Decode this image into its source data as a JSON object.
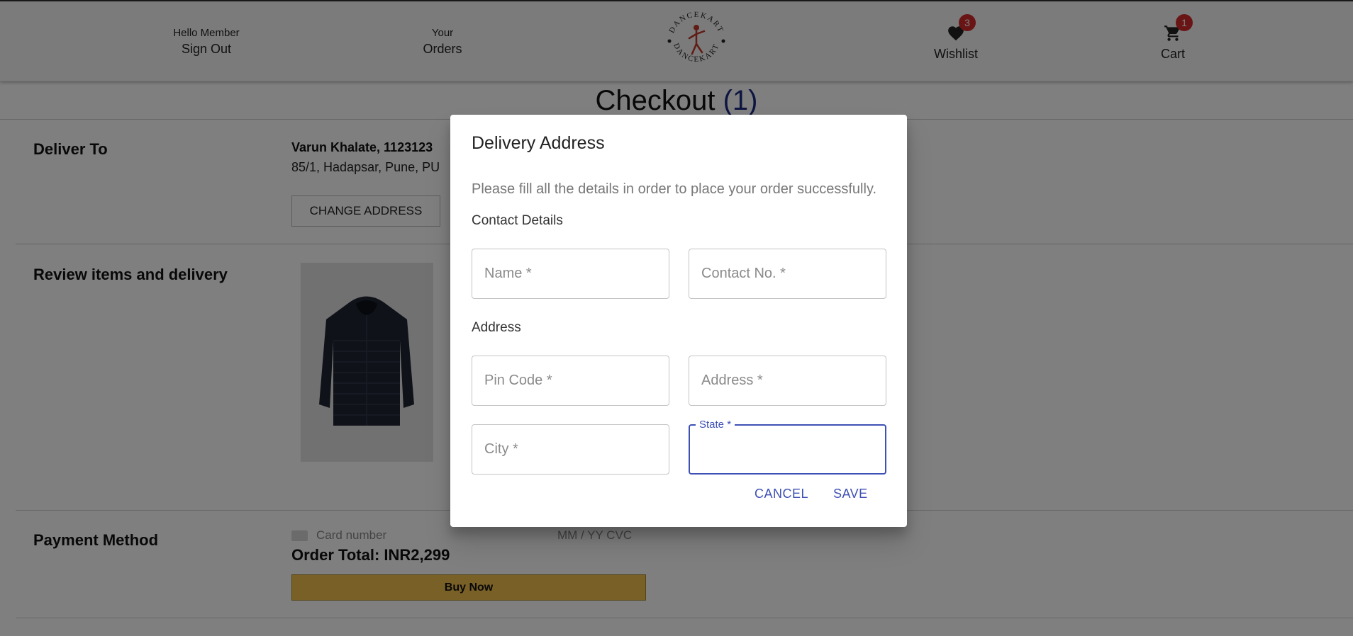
{
  "header": {
    "member_greeting": "Hello Member",
    "sign_out": "Sign Out",
    "your": "Your",
    "orders": "Orders",
    "logo_text": "DANCEKART",
    "wishlist_label": "Wishlist",
    "wishlist_count": "3",
    "cart_label": "Cart",
    "cart_count": "1"
  },
  "page": {
    "title": "Checkout",
    "count": "(1)"
  },
  "deliver": {
    "label": "Deliver To",
    "name": "Varun Khalate, 1123123",
    "address": "85/1, Hadapsar, Pune, PU",
    "change_button": "CHANGE ADDRESS"
  },
  "review": {
    "label": "Review items and delivery"
  },
  "payment": {
    "label": "Payment Method",
    "card_placeholder": "Card number",
    "expiry_cvc_placeholder": "MM / YY  CVC",
    "order_total": "Order Total: INR2,299",
    "buy_button": "Buy Now"
  },
  "dialog": {
    "title": "Delivery Address",
    "instruction": "Please fill all the details in order to place your order successfully.",
    "contact_section": "Contact Details",
    "address_section": "Address",
    "fields": {
      "name": "Name *",
      "contact": "Contact No. *",
      "pincode": "Pin Code *",
      "address": "Address *",
      "city": "City *",
      "state": "State *"
    },
    "cancel": "CANCEL",
    "save": "SAVE"
  },
  "colors": {
    "accent": "#3f51b5",
    "badge": "#d52b2b",
    "buy_button": "#f2c14e"
  },
  "icons": [
    "heart-icon",
    "cart-icon",
    "card-icon"
  ]
}
